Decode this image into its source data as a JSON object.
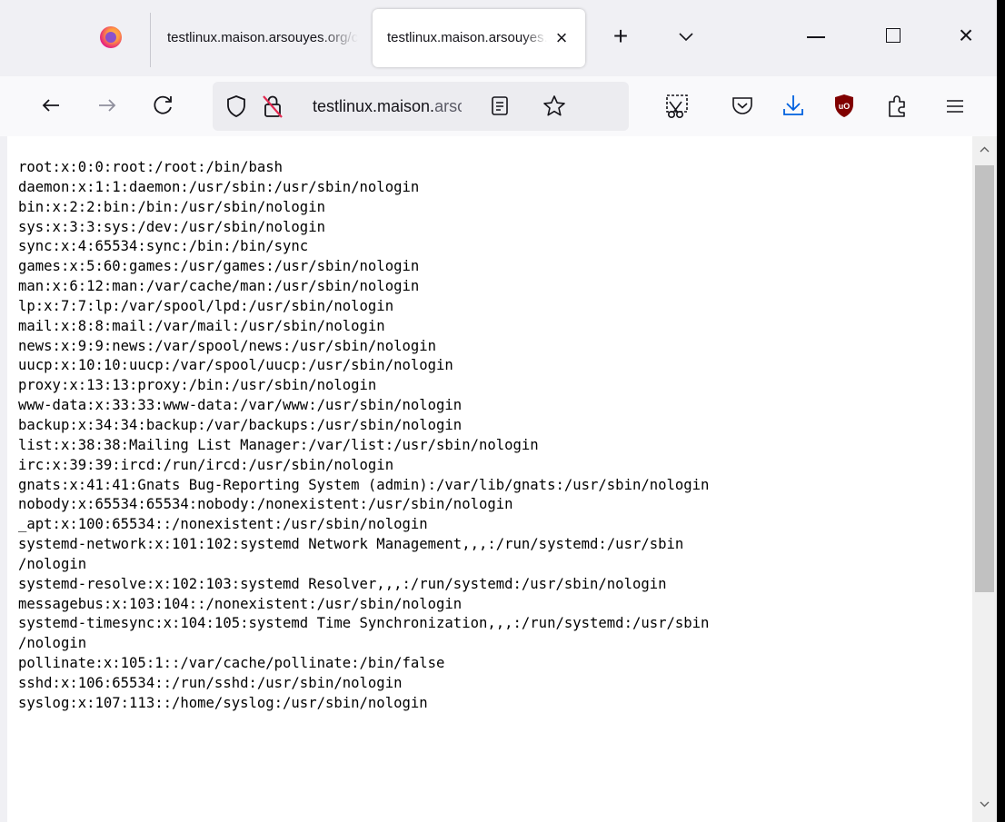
{
  "browser": {
    "tabs": [
      {
        "label": "testlinux.maison.arsouyes.org/cgi-bin/page",
        "active": false
      },
      {
        "label": "testlinux.maison.arsouyes.org/cgi-bin/page",
        "active": true
      }
    ],
    "tab_close_glyph": "×",
    "new_tab_glyph": "+",
    "window_close_glyph": "×",
    "nav": {
      "back_glyph": "←",
      "forward_glyph": "→",
      "reload_glyph": "C"
    },
    "url": {
      "domain": "testlinux.maison.",
      "rest": "arsouyes.org/cgi-bin/page"
    },
    "icons": [
      "firefox-logo",
      "chevron-down-icon",
      "shield-icon",
      "insecure-lock-icon",
      "reader-view-icon",
      "star-icon",
      "screenshot-icon",
      "pocket-icon",
      "download-icon",
      "ublock-origin-icon",
      "extensions-icon",
      "menu-icon"
    ],
    "colors": {
      "download_accent": "#0060df",
      "ublock_red": "#800000",
      "insecure_strike": "#e22850"
    }
  },
  "page": {
    "lines": [
      "root:x:0:0:root:/root:/bin/bash",
      "daemon:x:1:1:daemon:/usr/sbin:/usr/sbin/nologin",
      "bin:x:2:2:bin:/bin:/usr/sbin/nologin",
      "sys:x:3:3:sys:/dev:/usr/sbin/nologin",
      "sync:x:4:65534:sync:/bin:/bin/sync",
      "games:x:5:60:games:/usr/games:/usr/sbin/nologin",
      "man:x:6:12:man:/var/cache/man:/usr/sbin/nologin",
      "lp:x:7:7:lp:/var/spool/lpd:/usr/sbin/nologin",
      "mail:x:8:8:mail:/var/mail:/usr/sbin/nologin",
      "news:x:9:9:news:/var/spool/news:/usr/sbin/nologin",
      "uucp:x:10:10:uucp:/var/spool/uucp:/usr/sbin/nologin",
      "proxy:x:13:13:proxy:/bin:/usr/sbin/nologin",
      "www-data:x:33:33:www-data:/var/www:/usr/sbin/nologin",
      "backup:x:34:34:backup:/var/backups:/usr/sbin/nologin",
      "list:x:38:38:Mailing List Manager:/var/list:/usr/sbin/nologin",
      "irc:x:39:39:ircd:/run/ircd:/usr/sbin/nologin",
      "gnats:x:41:41:Gnats Bug-Reporting System (admin):/var/lib/gnats:/usr/sbin/nologin",
      "nobody:x:65534:65534:nobody:/nonexistent:/usr/sbin/nologin",
      "_apt:x:100:65534::/nonexistent:/usr/sbin/nologin",
      "systemd-network:x:101:102:systemd Network Management,,,:/run/systemd:/usr/sbin\n/nologin",
      "systemd-resolve:x:102:103:systemd Resolver,,,:/run/systemd:/usr/sbin/nologin",
      "messagebus:x:103:104::/nonexistent:/usr/sbin/nologin",
      "systemd-timesync:x:104:105:systemd Time Synchronization,,,:/run/systemd:/usr/sbin\n/nologin",
      "pollinate:x:105:1::/var/cache/pollinate:/bin/false",
      "sshd:x:106:65534::/run/sshd:/usr/sbin/nologin",
      "syslog:x:107:113::/home/syslog:/usr/sbin/nologin"
    ]
  }
}
